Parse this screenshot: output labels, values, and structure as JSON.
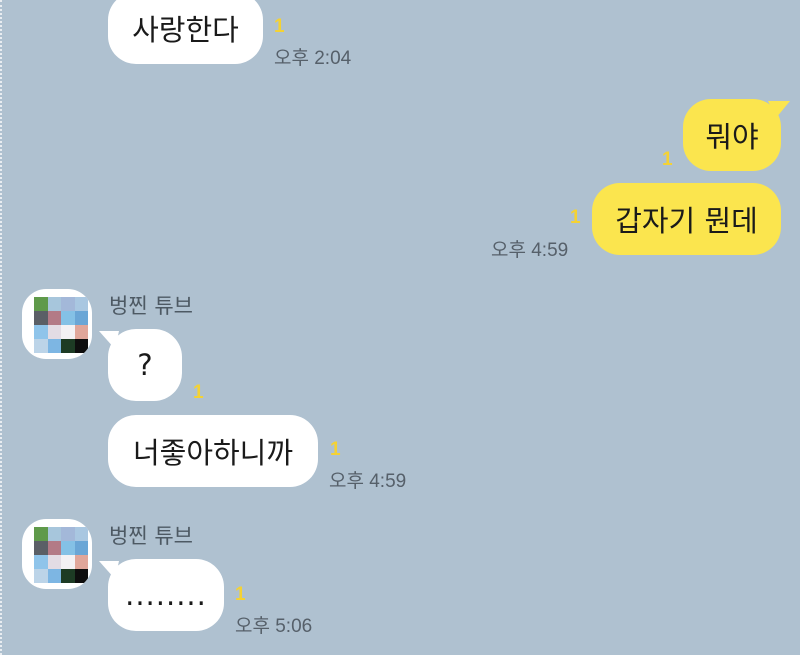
{
  "colors": {
    "chat_background": "#afc1d0",
    "incoming_bubble": "#ffffff",
    "outgoing_bubble": "#fbe54e",
    "unread_count": "#f4d234",
    "time_text": "#56606a",
    "sender_name": "#4d5963"
  },
  "messages": [
    {
      "direction": "incoming",
      "text": "사랑한다",
      "unread": "1",
      "time": "오후 2:04"
    },
    {
      "direction": "outgoing",
      "text": "뭐야",
      "unread": "1"
    },
    {
      "direction": "outgoing",
      "text": "갑자기 뭔데",
      "unread": "1",
      "time": "오후 4:59"
    },
    {
      "direction": "incoming",
      "sender": "벙찐 튜브",
      "text": "?",
      "unread": "1"
    },
    {
      "direction": "incoming",
      "text": "너좋아하니까",
      "unread": "1",
      "time": "오후 4:59"
    },
    {
      "direction": "incoming",
      "sender": "벙찐 튜브",
      "text": "........",
      "unread": "1",
      "time": "오후 5:06"
    }
  ],
  "avatar": {
    "description_icon": "pixelated-avatar-icon"
  }
}
